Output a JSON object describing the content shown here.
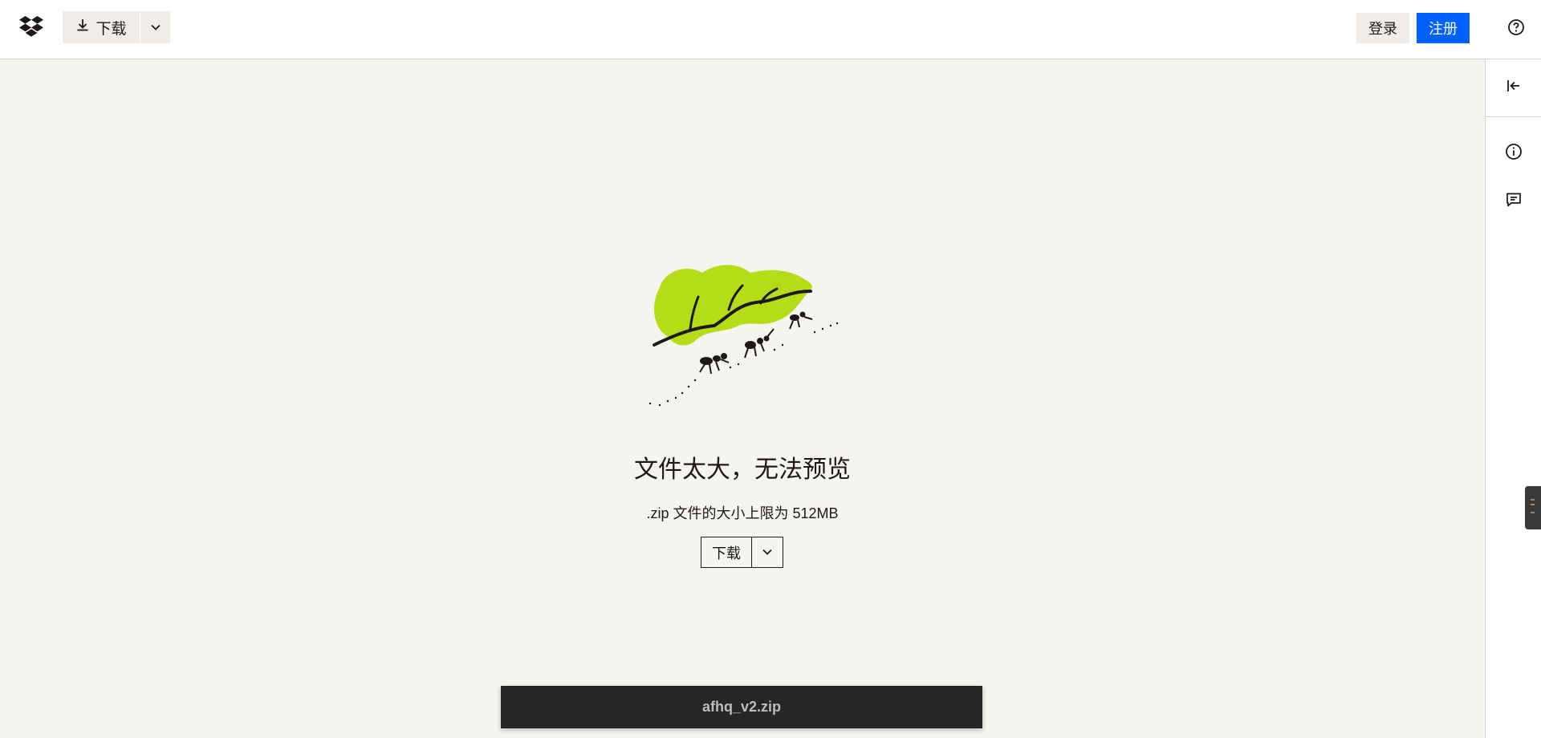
{
  "header": {
    "logo_icon": "dropbox-logo-icon",
    "download_label": "下载",
    "download_icon": "download-icon",
    "dropdown_icon": "chevron-down-icon",
    "login_label": "登录",
    "signup_label": "注册",
    "help_icon": "help-circle-icon",
    "signup_color": "#0061fe"
  },
  "sidebar": {
    "collapse_icon": "collapse-left-icon",
    "info_icon": "info-icon",
    "comment_icon": "comment-icon"
  },
  "preview": {
    "illustration": "ants-carrying-leaf-illustration",
    "title": "文件太大，无法预览",
    "subtitle": ".zip 文件的大小上限为 512MB",
    "download_label": "下载",
    "leaf_color": "#b4dc19"
  },
  "filebar": {
    "filename": "afhq_v2.zip"
  }
}
